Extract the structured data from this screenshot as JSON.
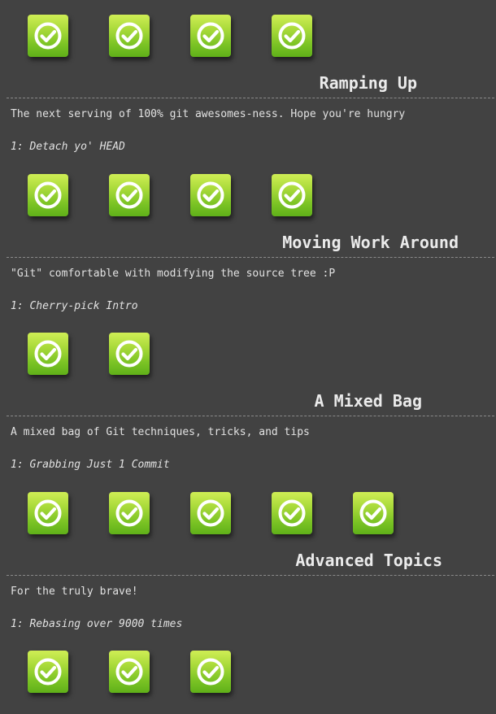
{
  "top_row": {
    "levels": [
      {
        "state": "completed",
        "icon": "check-circle-icon"
      },
      {
        "state": "completed",
        "icon": "check-circle-icon"
      },
      {
        "state": "completed",
        "icon": "check-circle-icon"
      },
      {
        "state": "completed",
        "icon": "check-circle-icon"
      }
    ]
  },
  "sections": [
    {
      "title": "Ramping Up",
      "description": "The next serving of 100% git awesomes-ness. Hope you're hungry",
      "level_name": "1: Detach yo' HEAD",
      "levels": [
        {
          "state": "completed",
          "icon": "check-circle-icon"
        },
        {
          "state": "completed",
          "icon": "check-circle-icon"
        },
        {
          "state": "completed",
          "icon": "check-circle-icon"
        },
        {
          "state": "completed",
          "icon": "check-circle-icon"
        }
      ]
    },
    {
      "title": "Moving Work Around",
      "description": "\"Git\" comfortable with modifying the source tree :P",
      "level_name": "1: Cherry-pick Intro",
      "levels": [
        {
          "state": "completed",
          "icon": "check-circle-icon"
        },
        {
          "state": "completed",
          "icon": "check-circle-icon"
        }
      ]
    },
    {
      "title": "A Mixed Bag",
      "description": "A mixed bag of Git techniques, tricks, and tips",
      "level_name": "1: Grabbing Just 1 Commit",
      "levels": [
        {
          "state": "completed",
          "icon": "check-circle-icon"
        },
        {
          "state": "completed",
          "icon": "check-circle-icon"
        },
        {
          "state": "completed",
          "icon": "check-circle-icon"
        },
        {
          "state": "completed",
          "icon": "check-circle-icon"
        },
        {
          "state": "completed",
          "icon": "check-circle-icon"
        }
      ]
    },
    {
      "title": "Advanced Topics",
      "description": "For the truly brave!",
      "level_name": "1: Rebasing over 9000 times",
      "levels": [
        {
          "state": "completed",
          "icon": "check-circle-icon"
        },
        {
          "state": "completed",
          "icon": "check-circle-icon"
        },
        {
          "state": "completed",
          "icon": "check-circle-icon"
        }
      ]
    }
  ],
  "colors": {
    "background": "#424242",
    "text": "#e2e2e2",
    "button_green": "#7cc425"
  }
}
